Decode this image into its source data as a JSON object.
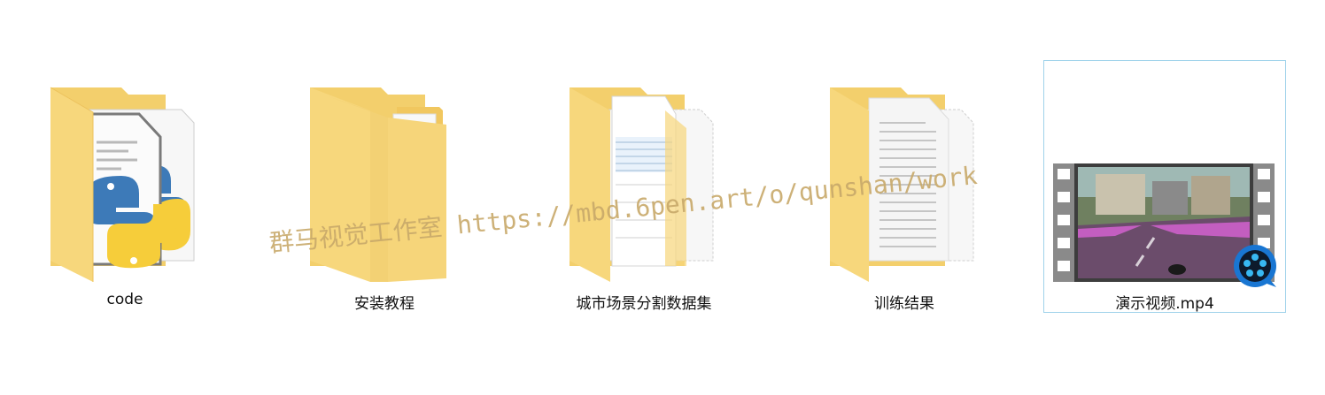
{
  "items": [
    {
      "label": "code",
      "icon": "python-folder-icon"
    },
    {
      "label": "安装教程",
      "icon": "document-folder-icon"
    },
    {
      "label": "城市场景分割数据集",
      "icon": "dataset-folder-icon"
    },
    {
      "label": "训练结果",
      "icon": "text-folder-icon"
    },
    {
      "label": "演示视频.mp4",
      "icon": "video-file-icon"
    }
  ],
  "watermark": "群马视觉工作室 https://mbd.6pen.art/o/qunshan/work",
  "colors": {
    "folder": "#f7d77c",
    "folder_dark": "#e9bf58",
    "selection_border": "#9fd2ea",
    "watermark": "#c8a96a"
  }
}
